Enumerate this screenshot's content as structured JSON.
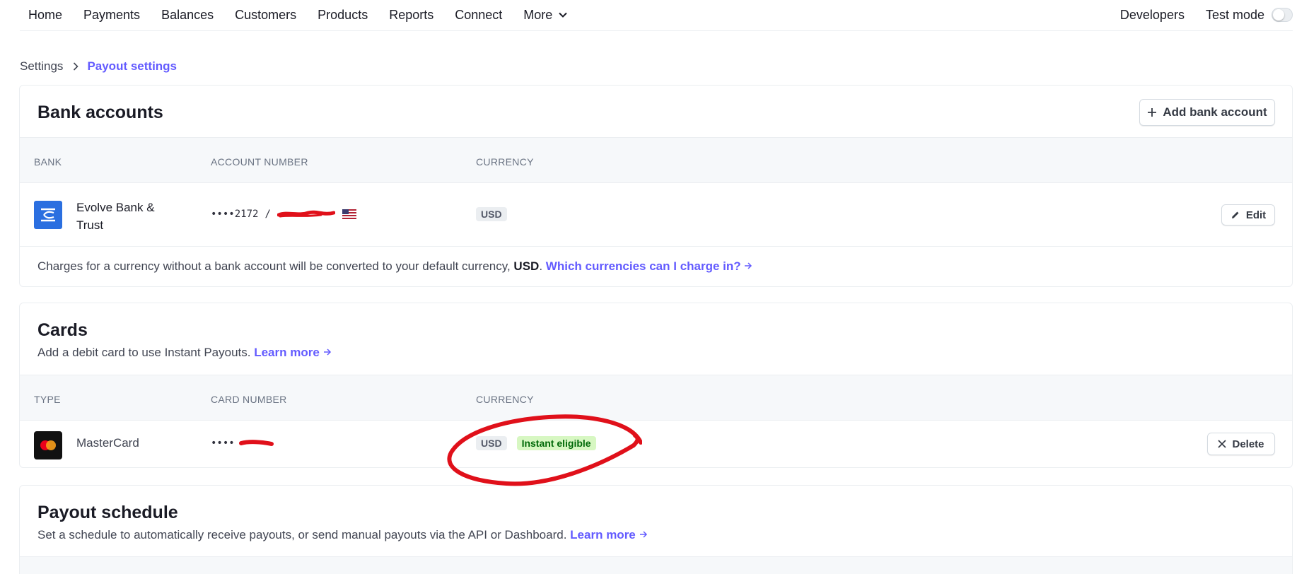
{
  "nav": {
    "items": [
      "Home",
      "Payments",
      "Balances",
      "Customers",
      "Products",
      "Reports",
      "Connect"
    ],
    "more_label": "More",
    "developers_label": "Developers",
    "test_mode_label": "Test mode"
  },
  "breadcrumb": {
    "root": "Settings",
    "current": "Payout settings"
  },
  "bank_accounts": {
    "title": "Bank accounts",
    "add_button": "Add bank account",
    "headers": [
      "BANK",
      "ACCOUNT NUMBER",
      "CURRENCY"
    ],
    "row": {
      "bank_line1": "Evolve Bank &",
      "bank_line2": "Trust",
      "account_masked": "••••2172",
      "account_sep": "/",
      "currency": "USD",
      "edit_label": "Edit"
    },
    "note_text": "Charges for a currency without a bank account will be converted to your default currency, ",
    "note_currency": "USD",
    "note_period": ".",
    "note_link": "Which currencies can I charge in?"
  },
  "cards": {
    "title": "Cards",
    "subtitle": "Add a debit card to use Instant Payouts.",
    "learn_more": "Learn more",
    "headers": [
      "TYPE",
      "CARD NUMBER",
      "CURRENCY"
    ],
    "row": {
      "type": "MasterCard",
      "card_masked": "••••",
      "currency": "USD",
      "instant_badge": "Instant eligible",
      "delete_label": "Delete"
    }
  },
  "payout_schedule": {
    "title": "Payout schedule",
    "subtitle": "Set a schedule to automatically receive payouts, or send manual payouts via the API or Dashboard.",
    "learn_more": "Learn more"
  },
  "colors": {
    "accent": "#635bff",
    "annotation": "#e0101a",
    "bank_logo": "#2b6fe0",
    "success_bg": "#d7f7c2",
    "success_text": "#006908"
  }
}
